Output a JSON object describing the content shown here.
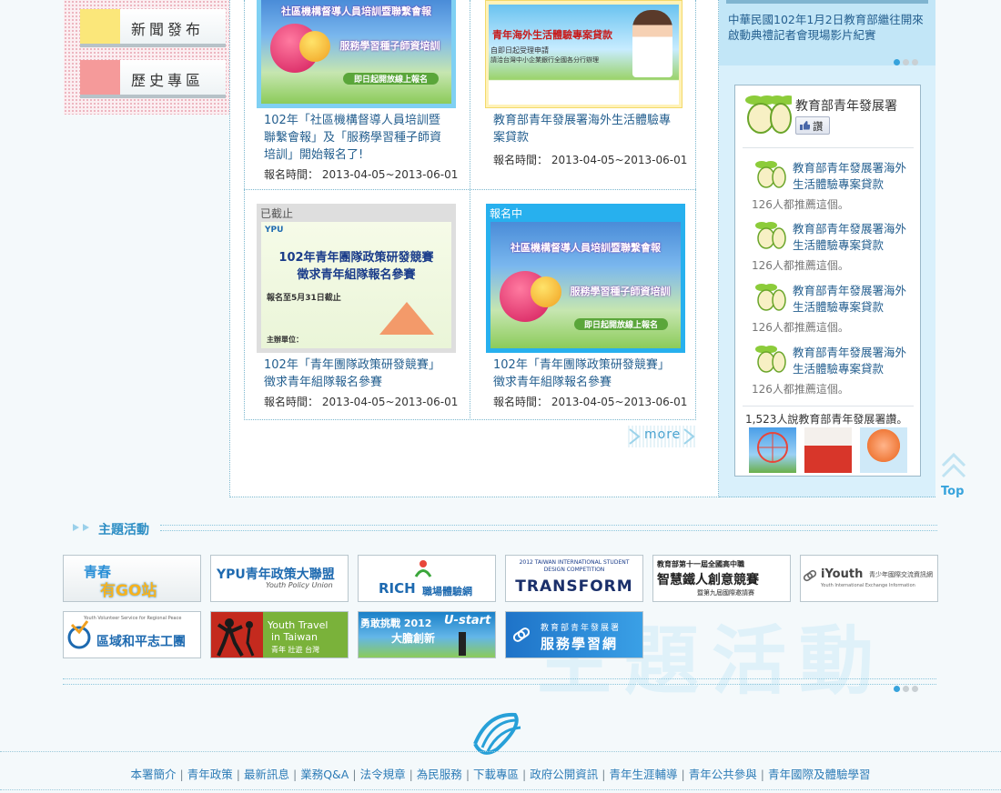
{
  "sidebar": {
    "items": [
      {
        "label": "新聞發布",
        "swatch": "#fbe77a"
      },
      {
        "label": "歷史專區",
        "swatch": "#f59a9a"
      }
    ]
  },
  "news": {
    "items": [
      {
        "title_line1": "102年「社區機構督導人員培訓暨",
        "title_line2": "聯繫會報」及「服務學習種子師資",
        "title_line3": "培訓」開始報名了!",
        "date": "報名時間： 2013-04-05~2013-06-01",
        "banner_l1": "社區機構督導人員培訓暨聯繫會報",
        "banner_l2": "服務學習種子師資培訓",
        "banner_l3": "即日起開放線上報名"
      },
      {
        "title_line1": "教育部青年發展署海外生活體驗專",
        "title_line2": "案貸款",
        "date": "報名時間： 2013-04-05~2013-06-01",
        "banner_l1": "青年海外生活體驗專案貸款",
        "banner_l2": "自即日起受理申請",
        "banner_l3": "請洽台灣中小企業銀行全國各分行辦理"
      },
      {
        "tag": "已截止",
        "title_line1": "102年「青年團隊政策研發競賽」",
        "title_line2": "徵求青年組隊報名參賽",
        "date": "報名時間： 2013-04-05~2013-06-01",
        "banner_l1": "102年青年團隊政策研發競賽",
        "banner_l2": "徵求青年組隊報名參賽",
        "banner_l3": "報名至5月31日截止",
        "banner_l4": "主辦單位："
      },
      {
        "tag": "報名中",
        "title_line1": "102年「青年團隊政策研發競賽」",
        "title_line2": "徵求青年組隊報名參賽",
        "date": "報名時間： 2013-04-05~2013-06-01",
        "banner_l1": "社區機構督導人員培訓暨聯繫會報",
        "banner_l2": "服務學習種子師資培訓",
        "banner_l3": "即日起開放線上報名"
      }
    ],
    "more_label": "more"
  },
  "right": {
    "video_caption_l1": "中華民國102年1月2日教育部繼往開來",
    "video_caption_l2": "啟動典禮記者會現場影片紀實",
    "fb": {
      "page_name": "教育部青年發展署",
      "like_label": "讚",
      "items": [
        {
          "title_l1": "教育部青年發展署海外",
          "title_l2": "生活體驗專案貸款",
          "sub": "126人都推薦這個。"
        },
        {
          "title_l1": "教育部青年發展署海外",
          "title_l2": "生活體驗專案貸款",
          "sub": "126人都推薦這個。"
        },
        {
          "title_l1": "教育部青年發展署海外",
          "title_l2": "生活體驗專案貸款",
          "sub": "126人都推薦這個。"
        },
        {
          "title_l1": "教育部青年發展署海外",
          "title_l2": "生活體驗專案貸款",
          "sub": "126人都推薦這個。"
        }
      ],
      "likes_count": "1,523人說教育部青年發展署讚。"
    },
    "top_label": "Top"
  },
  "activities": {
    "heading": "主題活動",
    "watermark": "主題活動",
    "tiles": [
      {
        "l1": "青春",
        "l2": "有GO站"
      },
      {
        "l1": "YPU青年政策大聯盟",
        "l2": "Youth Policy Union"
      },
      {
        "l1": "RICH",
        "l2": "職場體驗網"
      },
      {
        "l1": "2012 TAIWAN INTERNATIONAL STUDENT DESIGN COMPETITION",
        "l2": "TRANSFORM"
      },
      {
        "l1": "教育部第十一屆全國高中職",
        "l2": "智慧鐵人創意競賽",
        "l3": "暨第九屆國際邀請賽"
      },
      {
        "l1": "iYouth",
        "l2": "青少年國際交流資訊網",
        "l3": "Youth International Exchange Information"
      },
      {
        "l1": "Youth Volunteer Service for Regional Peace",
        "l2": "區域和平志工團"
      },
      {
        "l1": "Youth Travel",
        "l2": "in Taiwan",
        "l3": "青年 壯遊 台灣"
      },
      {
        "l1": "勇敢挑戰 2012",
        "l2": "大膽創新",
        "l3": "U-start"
      },
      {
        "l1": "教育部青年發展署",
        "l2": "服務學習網"
      }
    ]
  },
  "footer": {
    "links": [
      "本署簡介",
      "青年政策",
      "最新訊息",
      "業務Q&A",
      "法令規章",
      "為民服務",
      "下載專區",
      "政府公開資訊",
      "青年生涯輔導",
      "青年公共參與",
      "青年國際及體驗學習"
    ],
    "separator": "|"
  },
  "colors": {
    "accent": "#37a3dc",
    "link": "#245f8f"
  }
}
